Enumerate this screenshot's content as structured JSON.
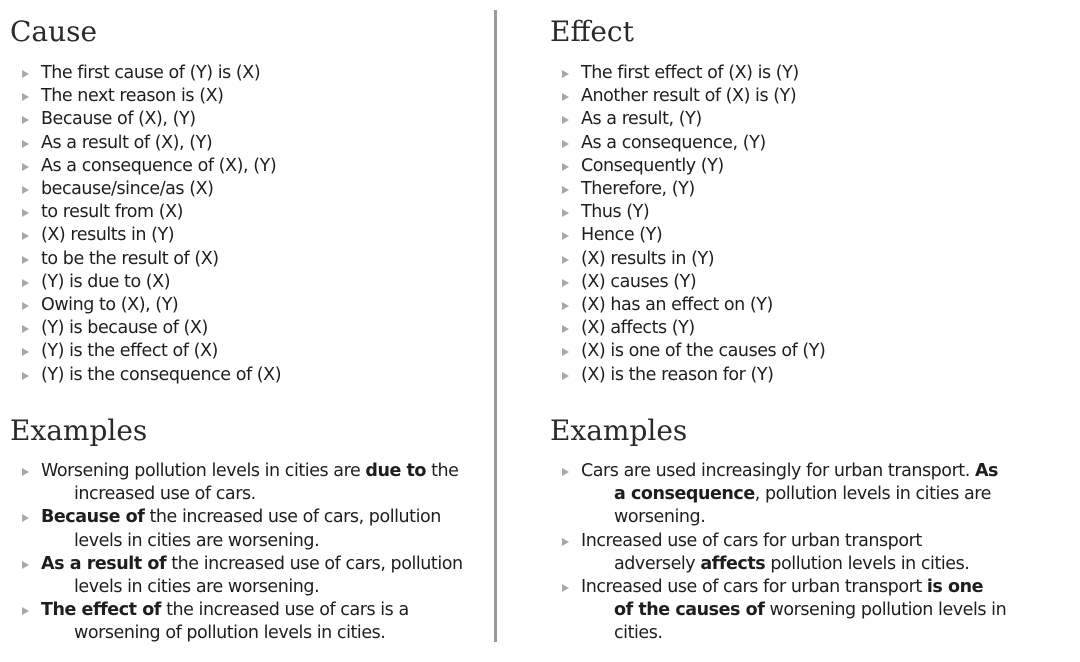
{
  "cause": {
    "title": "Cause",
    "phrases": [
      "The first cause of (Y) is (X)",
      "The next reason is (X)",
      "Because of (X), (Y)",
      "As a result of (X), (Y)",
      "As a consequence of (X), (Y)",
      "because/since/as (X)",
      "to result from (X)",
      "(X) results in (Y)",
      "to be the result of (X)",
      "(Y) is due to (X)",
      "Owing to (X), (Y)",
      "(Y) is because of (X)",
      "(Y) is the effect of (X)",
      "(Y) is the consequence of (X)"
    ],
    "examples_title": "Examples",
    "examples": [
      {
        "l1_pre": "Worsening pollution levels in cities are ",
        "l1_bold": "due to",
        "l1_post": " the",
        "l2_bold": "",
        "l2_post": "increased use of cars.",
        "l3": ""
      },
      {
        "l1_pre": "",
        "l1_bold": "Because of",
        "l1_post": " the increased use of cars, pollution",
        "l2_bold": "",
        "l2_post": "levels in cities are worsening.",
        "l3": ""
      },
      {
        "l1_pre": "",
        "l1_bold": "As a result of",
        "l1_post": " the increased use of cars, pollution",
        "l2_bold": "",
        "l2_post": "levels in cities are worsening.",
        "l3": ""
      },
      {
        "l1_pre": "",
        "l1_bold": "The effect of",
        "l1_post": " the increased use of cars is a",
        "l2_bold": "",
        "l2_post": "worsening of pollution levels in cities.",
        "l3": ""
      }
    ]
  },
  "effect": {
    "title": "Effect",
    "phrases": [
      "The first effect of (X) is (Y)",
      "Another result of (X) is (Y)",
      "As a result, (Y)",
      "As a consequence, (Y)",
      "Consequently (Y)",
      "Therefore, (Y)",
      "Thus (Y)",
      "Hence (Y)",
      "(X) results in (Y)",
      "(X) causes (Y)",
      "(X) has an effect on (Y)",
      "(X) affects (Y)",
      "(X) is one of the causes of (Y)",
      "(X) is the reason for (Y)"
    ],
    "examples_title": "Examples",
    "examples": [
      {
        "l1_pre": "Cars are used increasingly for urban transport. ",
        "l1_bold": "As",
        "l1_post": "",
        "l2_bold": "a consequence",
        "l2_post": ", pollution levels in cities are",
        "l3": "worsening."
      },
      {
        "l1_pre": "Increased use of cars for urban transport",
        "l1_bold": "",
        "l1_post": "",
        "l2_pre": "adversely ",
        "l2_bold": "affects",
        "l2_post": " pollution levels in cities.",
        "l3": ""
      },
      {
        "l1_pre": "Increased use of cars for urban transport ",
        "l1_bold": "is one",
        "l1_post": "",
        "l2_bold": "of the causes of",
        "l2_post": " worsening pollution levels in",
        "l3": "cities."
      }
    ]
  }
}
